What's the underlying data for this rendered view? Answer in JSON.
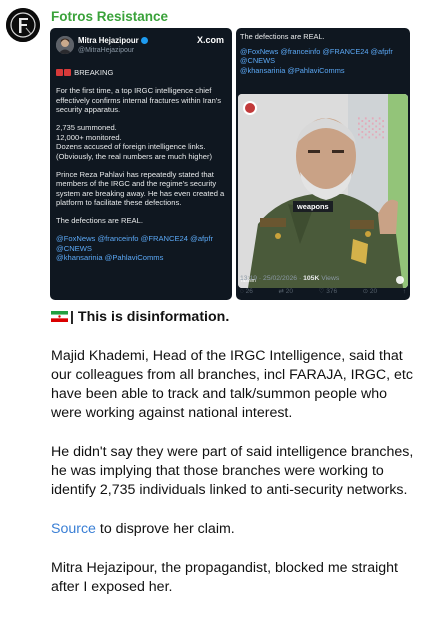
{
  "channel": {
    "name": "Fotros Resistance",
    "accent": "#3aa23a"
  },
  "tweet_left": {
    "author_name": "Mitra Hejazipour",
    "author_handle": "@MitraHejazipour",
    "platform": "X.com",
    "breaking": "BREAKING",
    "p1": "For the first time, a top IRGC intelligence chief effectively confirms internal fractures within Iran's security apparatus.",
    "p2a": "2,735 summoned.",
    "p2b": "12,000+ monitored.",
    "p2c": "Dozens accused of foreign intelligence links.",
    "p2d": "(Obviously, the real numbers are much higher)",
    "p3": "Prince Reza Pahlavi has repeatedly stated that members of the IRGC and the regime's security system are breaking away. He has even created a platform to facilitate these defections.",
    "p4": "The defections are REAL.",
    "links1": "@FoxNews @franceinfo @FRANCE24 @afpfr",
    "links2": "@CNEWS",
    "links3": "@khansarinia @PahlaviComms"
  },
  "tweet_right": {
    "line1": "The defections are REAL.",
    "links1": "@FoxNews @franceinfo @FRANCE24 @afpfr",
    "links2": "@CNEWS",
    "links3": "@khansarinia @PahlaviComms",
    "video_caption": "weapons",
    "watermark": "Tasnim",
    "time": "13:19 · 25/02/2026 ·",
    "views": "105K",
    "views_label": "Views",
    "actions": [
      "◌ 26",
      "⇄ 20",
      "♡ 376",
      "⊙ 20",
      "↑"
    ]
  },
  "message": {
    "heading": "| This is disinformation.",
    "para1": "Majid Khademi, Head of the IRGC Intelligence, said that our colleagues from all branches, incl FARAJA, IRGC, etc have been able to track and talk/summon people who were working against national interest.",
    "para2": "He didn't say they were part of said intelligence branches, he was implying that those branches were working to identify 2,735 individuals linked to anti-security networks.",
    "source_link": "Source",
    "source_rest": " to disprove her claim.",
    "para3": "Mitra Hejazipour, the propagandist, blocked me straight after I exposed her."
  }
}
